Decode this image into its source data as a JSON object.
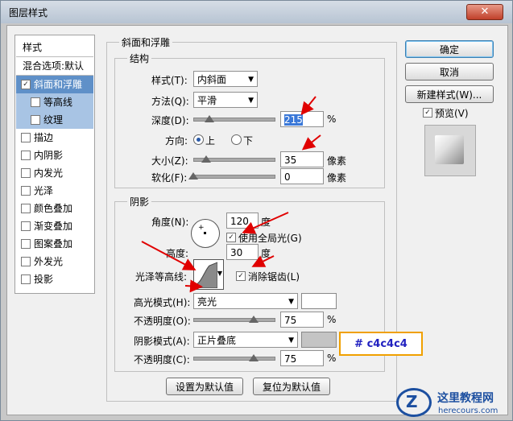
{
  "window": {
    "title": "图层样式",
    "close_glyph": "✕"
  },
  "style_list": {
    "header": "样式",
    "blend_options": "混合选项:默认",
    "items": [
      {
        "label": "斜面和浮雕",
        "checked": true
      },
      {
        "label": "等高线",
        "checked": false
      },
      {
        "label": "纹理",
        "checked": false
      },
      {
        "label": "描边",
        "checked": false
      },
      {
        "label": "内阴影",
        "checked": false
      },
      {
        "label": "内发光",
        "checked": false
      },
      {
        "label": "光泽",
        "checked": false
      },
      {
        "label": "颜色叠加",
        "checked": false
      },
      {
        "label": "渐变叠加",
        "checked": false
      },
      {
        "label": "图案叠加",
        "checked": false
      },
      {
        "label": "外发光",
        "checked": false
      },
      {
        "label": "投影",
        "checked": false
      }
    ],
    "check_glyph": "✓"
  },
  "bevel": {
    "section_title": "斜面和浮雕",
    "structure": {
      "title": "结构",
      "style_label": "样式(T):",
      "style_value": "内斜面",
      "technique_label": "方法(Q):",
      "technique_value": "平滑",
      "depth_label": "深度(D):",
      "depth_value": "215",
      "depth_unit": "%",
      "depth_level_pct": 20,
      "direction_label": "方向:",
      "dir_up": "上",
      "dir_down": "下",
      "size_label": "大小(Z):",
      "size_value": "35",
      "size_unit": "像素",
      "size_level_pct": 16,
      "soften_label": "软化(F):",
      "soften_value": "0",
      "soften_unit": "像素",
      "soften_level_pct": 0
    },
    "shading": {
      "title": "阴影",
      "angle_label": "角度(N):",
      "angle_value": "120",
      "angle_unit": "度",
      "global_light_label": "使用全局光(G)",
      "altitude_label": "高度:",
      "altitude_value": "30",
      "altitude_unit": "度",
      "gloss_label": "光泽等高线:",
      "antialias_label": "消除锯齿(L)",
      "highlight_mode_label": "高光模式(H):",
      "highlight_mode_value": "亮光",
      "highlight_color": "#ffffff",
      "highlight_opacity_label": "不透明度(O):",
      "highlight_opacity_value": "75",
      "highlight_opacity_unit": "%",
      "highlight_opacity_level_pct": 75,
      "shadow_mode_label": "阴影模式(A):",
      "shadow_mode_value": "正片叠底",
      "shadow_color": "#c4c4c4",
      "shadow_opacity_label": "不透明度(C):",
      "shadow_opacity_value": "75",
      "shadow_opacity_unit": "%",
      "shadow_opacity_level_pct": 75
    },
    "make_default_label": "设置为默认值",
    "reset_default_label": "复位为默认值"
  },
  "buttons": {
    "ok": "确定",
    "cancel": "取消",
    "new_style": "新建样式(W)...",
    "preview_label": "预览(V)"
  },
  "callout_text": "# c4c4c4",
  "watermark": {
    "text": "这里教程网",
    "url": "herecours.com"
  },
  "colors": {
    "selection": "#5f90c8",
    "sub_selection": "#a8c4e4",
    "arrow": "#e00000",
    "callout_border": "#f0a000"
  }
}
